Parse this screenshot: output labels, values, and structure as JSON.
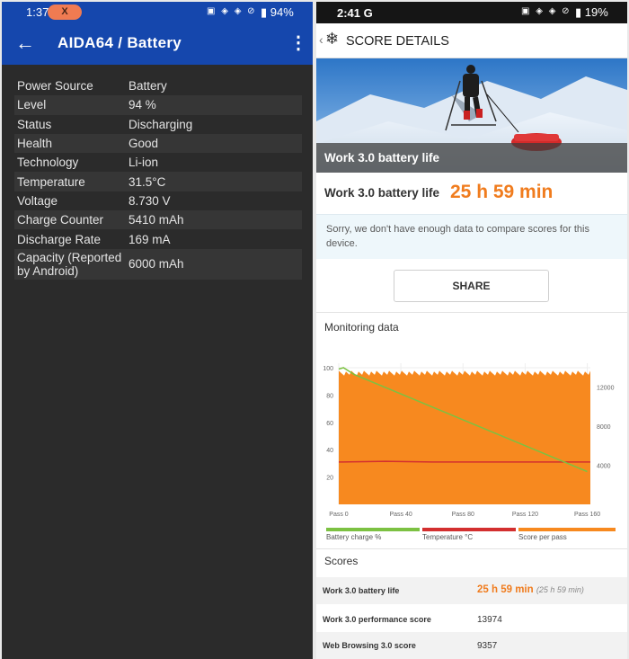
{
  "left": {
    "status": {
      "time": "1:37",
      "pill": "X",
      "battery": "94%"
    },
    "app_title": "AIDA64  /  Battery",
    "rows": [
      {
        "key": "Power Source",
        "value": "Battery"
      },
      {
        "key": "Level",
        "value": "94 %"
      },
      {
        "key": "Status",
        "value": "Discharging"
      },
      {
        "key": "Health",
        "value": "Good"
      },
      {
        "key": "Technology",
        "value": "Li-ion"
      },
      {
        "key": "Temperature",
        "value": "31.5°C"
      },
      {
        "key": "Voltage",
        "value": "8.730 V"
      },
      {
        "key": "Charge Counter",
        "value": "5410 mAh"
      },
      {
        "key": "Discharge Rate",
        "value": "169 mA"
      },
      {
        "key": "Capacity (Reported by Android)",
        "value": "6000 mAh"
      }
    ]
  },
  "right": {
    "status": {
      "time": "2:41",
      "carrier": "G",
      "battery": "19%"
    },
    "header_title": "SCORE DETAILS",
    "hero_caption": "Work 3.0 battery life",
    "score_label": "Work 3.0 battery life",
    "score_value": "25 h 59 min",
    "note": "Sorry, we don't have enough data to compare scores for this device.",
    "share_label": "SHARE",
    "monitoring_title": "Monitoring data",
    "scores_title": "Scores",
    "legend": [
      "Battery charge %",
      "Temperature °C",
      "Score per pass"
    ],
    "scores": [
      {
        "label": "Work 3.0 battery life",
        "value": "25 h 59 min",
        "sub": "(25 h 59 min)"
      },
      {
        "label": "Work 3.0 performance score",
        "value": "13974"
      },
      {
        "label": "Web Browsing 3.0 score",
        "value": "9357"
      }
    ],
    "colors": {
      "accent": "#f07c1e",
      "battery": "#7cc142",
      "temperature": "#d32f2f",
      "score": "#f7891f"
    }
  },
  "chart_data": {
    "type": "line",
    "x_ticks": [
      "Pass 0",
      "Pass 40",
      "Pass 80",
      "Pass 120",
      "Pass 160"
    ],
    "x_tick_values": [
      0,
      40,
      80,
      120,
      160
    ],
    "xlim": [
      0,
      162
    ],
    "left_ticks": [
      20,
      40,
      60,
      80,
      100
    ],
    "left_ylim": [
      0,
      100
    ],
    "right_ticks": [
      4000,
      8000,
      12000
    ],
    "right_ylim": [
      0,
      14000
    ],
    "series": [
      {
        "name": "Battery charge %",
        "axis": "left",
        "points": [
          [
            0,
            99
          ],
          [
            3,
            100
          ],
          [
            10,
            95
          ],
          [
            160,
            24
          ]
        ]
      },
      {
        "name": "Temperature °C",
        "axis": "left",
        "points": [
          [
            0,
            31
          ],
          [
            30,
            31.5
          ],
          [
            60,
            31
          ],
          [
            120,
            31
          ],
          [
            162,
            31
          ]
        ]
      },
      {
        "name": "Score per pass",
        "axis": "left",
        "type": "area",
        "approx_value": 96
      }
    ]
  }
}
